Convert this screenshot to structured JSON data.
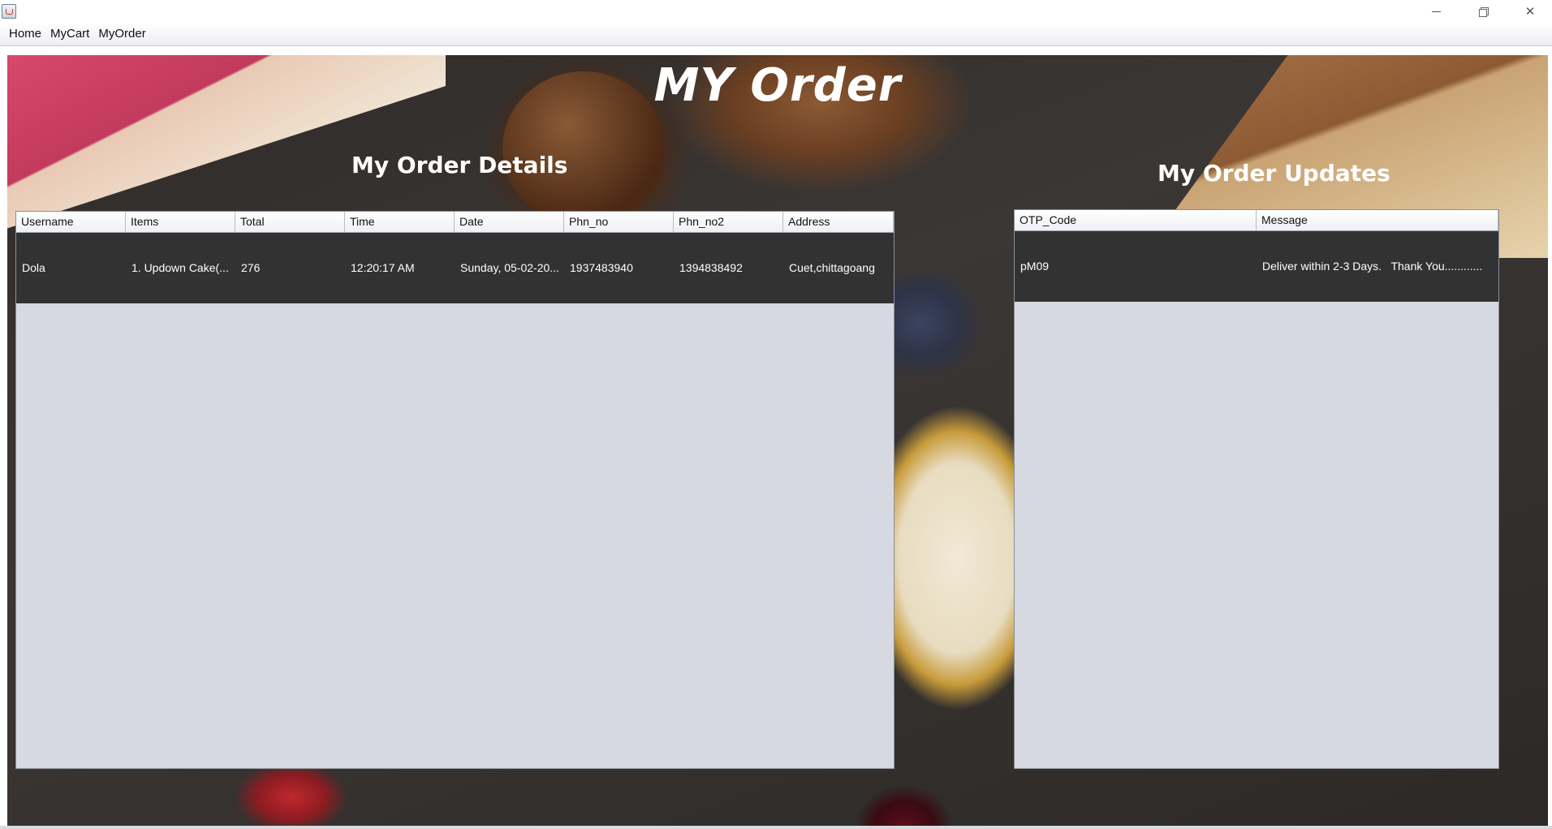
{
  "window": {
    "minimize_icon": "minimize-icon",
    "maximize_icon": "restore-icon",
    "close_icon": "close-icon"
  },
  "menu": [
    "Home",
    "MyCart",
    "MyOrder"
  ],
  "page": {
    "title": "MY Order",
    "details_title": "My Order Details",
    "updates_title": "My Order Updates"
  },
  "order_table": {
    "columns": [
      "Username",
      "Items",
      "Total",
      "Time",
      "Date",
      "Phn_no",
      "Phn_no2",
      "Address"
    ],
    "rows": [
      [
        "Dola",
        "1. Updown Cake(...",
        "276",
        "12:20:17 AM",
        "Sunday, 05-02-20...",
        "1937483940",
        "1394838492",
        "Cuet,chittagoang"
      ]
    ]
  },
  "updates_table": {
    "columns": [
      "OTP_Code",
      "Message"
    ],
    "rows": [
      [
        "pM09",
        "Deliver within 2-3 Days.   Thank You............"
      ]
    ]
  },
  "colors": {
    "selected_row": "#323232",
    "table_bg": "#d6d9e2",
    "title_text": "#ffffff"
  }
}
